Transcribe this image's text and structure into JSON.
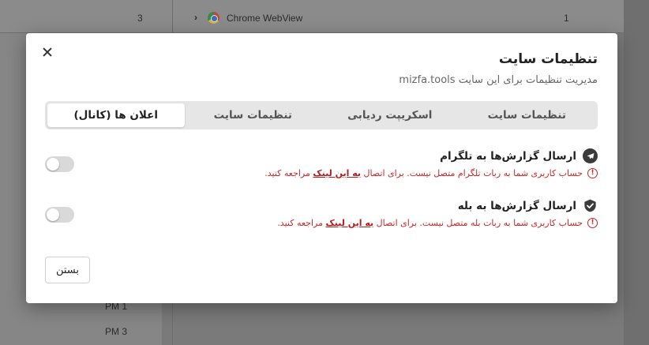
{
  "background": {
    "top_count": "3",
    "chrome_label": "Chrome WebView",
    "top_right_count": "1",
    "row_pm1": "PM 1",
    "row_pm3": "PM 3"
  },
  "modal": {
    "title": "تنظیمات سایت",
    "subtitle": "مدیریت تنظیمات برای این سایت mizfa.tools",
    "tabs": [
      {
        "label": "تنظیمات سایت",
        "active": false
      },
      {
        "label": "اسکریپت ردیابی",
        "active": false
      },
      {
        "label": "تنظیمات سایت",
        "active": false
      },
      {
        "label": "اعلان ها (کانال)",
        "active": true
      }
    ],
    "settings": [
      {
        "title": "ارسال گزارش‌ها به تلگرام",
        "icon": "telegram-icon",
        "error_before": "حساب کاربری شما به ربات تلگرام متصل نیست. برای اتصال ",
        "error_link": "به این لینک",
        "error_after": " مراجعه کنید.",
        "enabled": false
      },
      {
        "title": "ارسال گزارش‌ها به بله",
        "icon": "bale-icon",
        "error_before": "حساب کاربری شما به ربات بله متصل نیست. برای اتصال ",
        "error_link": "به این لینک",
        "error_after": " مراجعه کنید.",
        "enabled": false
      }
    ],
    "close_label": "بستن"
  },
  "colors": {
    "error": "#c62828",
    "tab_bg": "#e6e6e6"
  }
}
